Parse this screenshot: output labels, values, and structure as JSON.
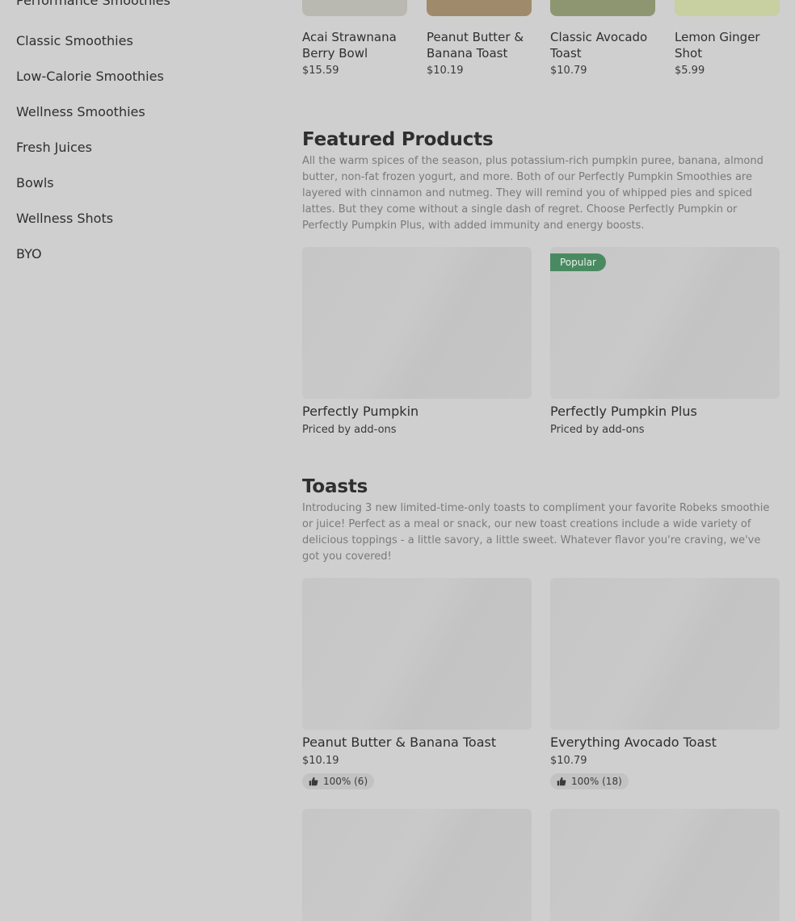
{
  "sidebar": {
    "categories": [
      "Performance Smoothies",
      "Classic Smoothies",
      "Low-Calorie Smoothies",
      "Wellness Smoothies",
      "Fresh Juices",
      "Bowls",
      "Wellness Shots",
      "BYO"
    ]
  },
  "top_row": [
    {
      "name": "Acai Strawnana Berry Bowl",
      "price": "$15.59",
      "thumb_color": "#b9b9b2"
    },
    {
      "name": "Peanut Butter & Banana Toast",
      "price": "$10.19",
      "thumb_color": "#a08a6c"
    },
    {
      "name": "Classic Avocado Toast",
      "price": "$10.79",
      "thumb_color": "#8d9670"
    },
    {
      "name": "Lemon Ginger Shot",
      "price": "$5.99",
      "thumb_color": "#c8cfa0"
    }
  ],
  "featured": {
    "title": "Featured Products",
    "description": "All the warm spices of the season, plus potassium-rich pumpkin puree, banana, almond butter, non-fat frozen yogurt, and more. Both of our Perfectly Pumpkin Smoothies are layered with cinnamon and nutmeg. They will remind you of whipped pies and spiced lattes. But they come without a single dash of regret. Choose Perfectly Pumpkin or Perfectly Pumpkin Plus, with added immunity and energy boosts.",
    "items": [
      {
        "name": "Perfectly Pumpkin",
        "price": "Priced by add-ons",
        "badge": ""
      },
      {
        "name": "Perfectly Pumpkin Plus",
        "price": "Priced by add-ons",
        "badge": "Popular"
      }
    ]
  },
  "toasts": {
    "title": "Toasts",
    "description": "Introducing 3 new limited-time-only toasts to compliment your favorite Robeks smoothie or juice! Perfect as a meal or snack, our new toast creations include a wide variety of delicious toppings - a little savory, a little sweet. Whatever flavor you're craving, we've got you covered!",
    "items": [
      {
        "name": "Peanut Butter & Banana Toast",
        "price": "$10.19",
        "rating": "100% (6)"
      },
      {
        "name": "Everything Avocado Toast",
        "price": "$10.79",
        "rating": "100% (18)"
      }
    ]
  },
  "colors": {
    "background": "#cfcfcf",
    "badge": "#4a8a62",
    "text": "#2f2f2f"
  }
}
